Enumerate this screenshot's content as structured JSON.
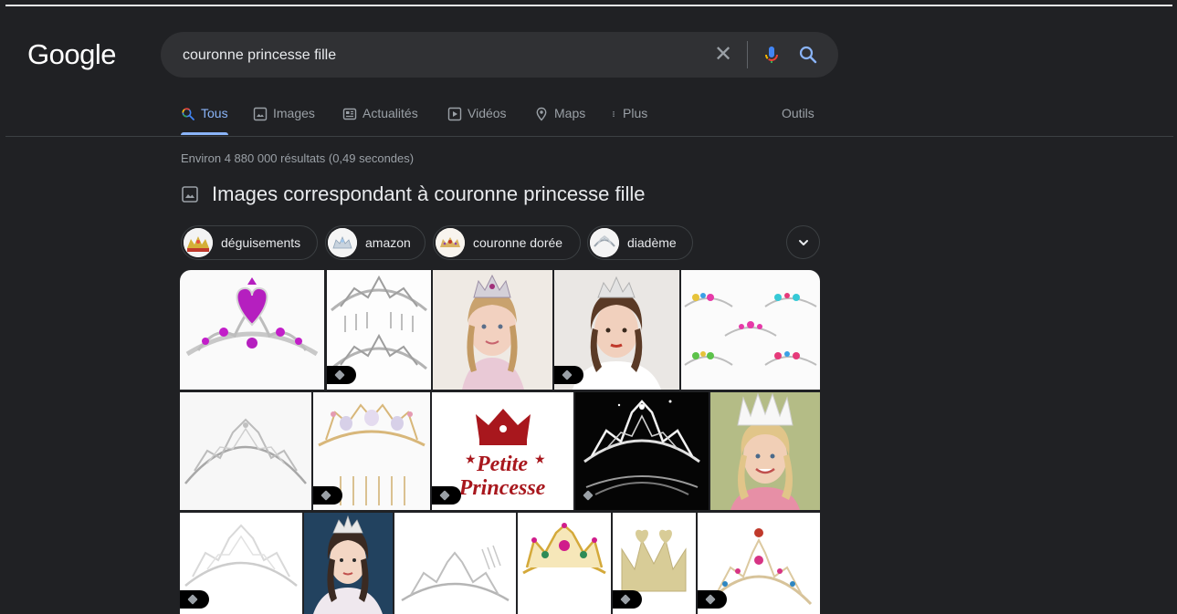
{
  "logo": "Google",
  "search": {
    "query": "couronne princesse fille",
    "clear_icon": "close-icon",
    "mic_icon": "microphone-icon",
    "search_icon": "search-icon"
  },
  "tabs": [
    {
      "label": "Tous",
      "icon": "search-icon",
      "active": true
    },
    {
      "label": "Images",
      "icon": "image-icon"
    },
    {
      "label": "Actualités",
      "icon": "news-icon"
    },
    {
      "label": "Vidéos",
      "icon": "video-icon"
    },
    {
      "label": "Maps",
      "icon": "map-pin-icon"
    },
    {
      "label": "Plus",
      "icon": "more-vert-icon"
    }
  ],
  "tools_label": "Outils",
  "results_stats": "Environ 4 880 000 résultats (0,49 secondes)",
  "images_heading": "Images correspondant à couronne princesse fille",
  "chips": [
    {
      "label": "déguisements"
    },
    {
      "label": "amazon"
    },
    {
      "label": "couronne dorée"
    },
    {
      "label": "diadème"
    }
  ],
  "tile_texts": {
    "petite": "Petite",
    "princesse": "Princesse"
  },
  "colors": {
    "background": "#202124",
    "accent": "#8ab4f8",
    "text": "#e8eaed",
    "muted": "#9aa0a6",
    "searchbox": "#303134"
  }
}
